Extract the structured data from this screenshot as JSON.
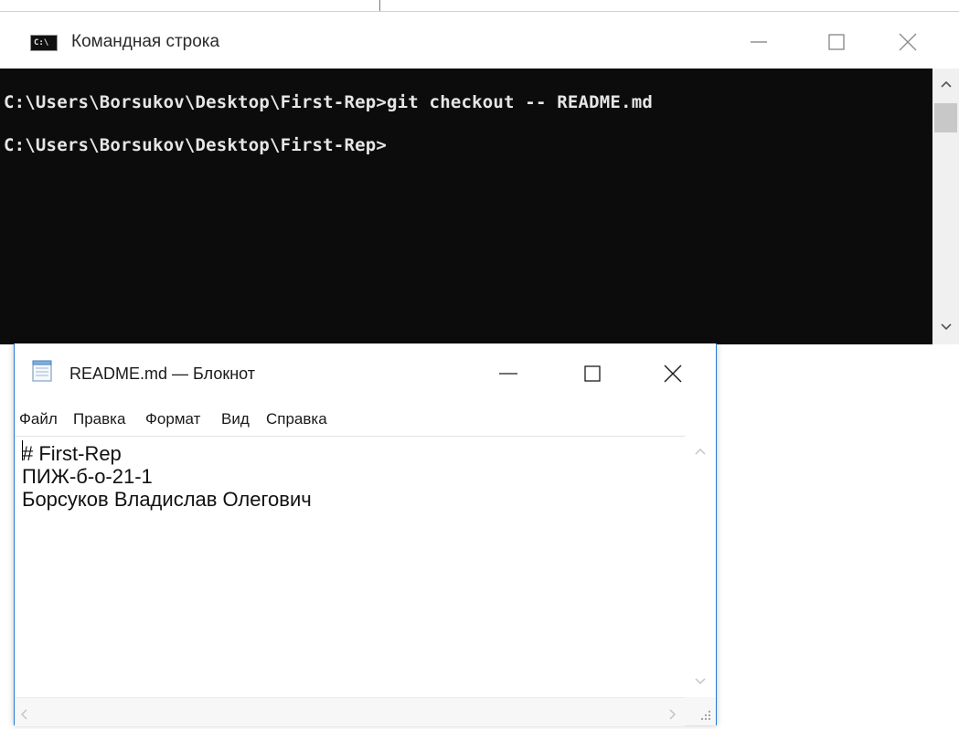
{
  "cmd": {
    "title": "Командная строка",
    "lines": [
      "C:\\Users\\Borsukov\\Desktop\\First-Rep>git checkout -- README.md",
      "C:\\Users\\Borsukov\\Desktop\\First-Rep>"
    ]
  },
  "notepad": {
    "title": "README.md — Блокнот",
    "menu": [
      "Файл",
      "Правка",
      "Формат",
      "Вид",
      "Справка"
    ],
    "content": "# First-Rep\nПИЖ-б-о-21-1\nБорсуков Владислав Олегович"
  },
  "icons": {
    "cmd": "command-prompt-icon",
    "notepad": "notepad-icon",
    "minimize": "minimize-icon",
    "maximize": "maximize-icon",
    "close": "close-icon"
  },
  "colors": {
    "console_bg": "#0c0c0c",
    "console_text": "#e6e6e6",
    "notepad_border": "#2b7cd3"
  }
}
